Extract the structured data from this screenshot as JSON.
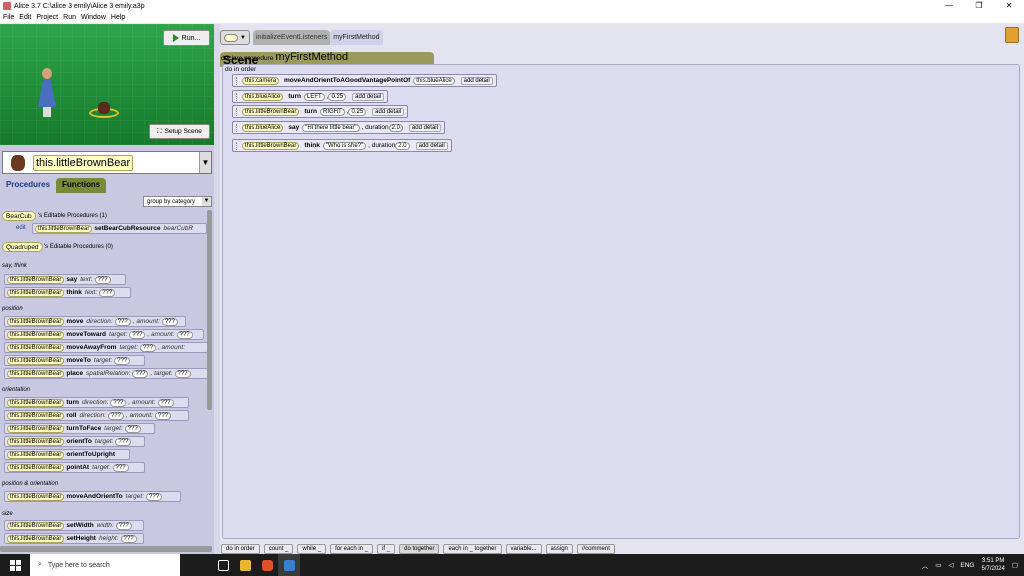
{
  "window": {
    "title": "Alice 3.7 C:\\alice 3 emily\\Alice 3 emily.a3p",
    "controls": [
      "—",
      "❐",
      "✕"
    ]
  },
  "menu": [
    "File",
    "Edit",
    "Project",
    "Run",
    "Window",
    "Help"
  ],
  "scene_view": {
    "run_label": "Run...",
    "setup_label": "Setup Scene"
  },
  "object_selector": {
    "value": "this.littleBrownBear"
  },
  "left_tabs": {
    "procedures": "Procedures",
    "functions": "Functions"
  },
  "group_by": "group by category",
  "editable": {
    "bearcub_type": "BearCub",
    "bearcub_text": "'s Editable Procedures (1)",
    "edit_label": "edit",
    "bearcub_method_ref": "this.littleBrownBear",
    "bearcub_method": "setBearCubResource",
    "bearcub_param": "bearCubR",
    "quadruped_type": "Quadruped",
    "quadruped_text": "'s Editable Procedures (0)"
  },
  "categories": {
    "say_think": "say, think",
    "position": "position",
    "orientation": "orientation",
    "position_orientation": "position & orientation",
    "size": "size"
  },
  "procedures": [
    {
      "ref": "this.littleBrownBear",
      "name": "say",
      "p1": "text:",
      "s1": "???"
    },
    {
      "ref": "this.littleBrownBear",
      "name": "think",
      "p1": "text:",
      "s1": "???"
    },
    {
      "ref": "this.littleBrownBear",
      "name": "move",
      "p1": "direction:",
      "s1": "???",
      "p2": ", amount:",
      "s2": "???"
    },
    {
      "ref": "this.littleBrownBear",
      "name": "moveToward",
      "p1": "target:",
      "s1": "???",
      "p2": ", amount:",
      "s2": "???"
    },
    {
      "ref": "this.littleBrownBear",
      "name": "moveAwayFrom",
      "p1": "target:",
      "s1": "???",
      "p2": ", amount:",
      "s2": ""
    },
    {
      "ref": "this.littleBrownBear",
      "name": "moveTo",
      "p1": "target:",
      "s1": "???"
    },
    {
      "ref": "this.littleBrownBear",
      "name": "place",
      "p1": "spatialRelation:",
      "s1": "???",
      "p2": ", target:",
      "s2": "???"
    },
    {
      "ref": "this.littleBrownBear",
      "name": "turn",
      "p1": "direction:",
      "s1": "???",
      "p2": ", amount:",
      "s2": "???"
    },
    {
      "ref": "this.littleBrownBear",
      "name": "roll",
      "p1": "direction:",
      "s1": "???",
      "p2": ", amount:",
      "s2": "???"
    },
    {
      "ref": "this.littleBrownBear",
      "name": "turnToFace",
      "p1": "target:",
      "s1": "???"
    },
    {
      "ref": "this.littleBrownBear",
      "name": "orientTo",
      "p1": "target:",
      "s1": "???"
    },
    {
      "ref": "this.littleBrownBear",
      "name": "orientToUpright"
    },
    {
      "ref": "this.littleBrownBear",
      "name": "pointAt",
      "p1": "target:",
      "s1": "???"
    },
    {
      "ref": "this.littleBrownBear",
      "name": "moveAndOrientTo",
      "p1": "target:",
      "s1": "???"
    },
    {
      "ref": "this.littleBrownBear",
      "name": "setWidth",
      "p1": "width:",
      "s1": "???"
    },
    {
      "ref": "this.littleBrownBear",
      "name": "setHeight",
      "p1": "height:",
      "s1": "???"
    }
  ],
  "editor_tabs": {
    "scene": "Scene",
    "initialize": "initializeEventListeners",
    "current": "myFirstMethod"
  },
  "method": {
    "declare": "declare procedure",
    "name": "myFirstMethod",
    "do_in_order": "do in order"
  },
  "statements": [
    {
      "ref": "this.camera",
      "name": "moveAndOrientToAGoodVantagePointOf",
      "a1": "this.blueAlice",
      "add": "add detail"
    },
    {
      "ref": "this.blueAlice",
      "name": "turn",
      "a1": "LEFT",
      "a2": "0.25",
      "add": "add detail"
    },
    {
      "ref": "this.littleBrownBear",
      "name": "turn",
      "a1": "RIGHT",
      "a2": "0.25",
      "add": "add detail"
    },
    {
      "ref": "this.blueAlice",
      "name": "say",
      "a1": "\"Hi there little bear\"",
      "dur": ", duration",
      "a2": "2.0",
      "add": "add detail"
    },
    {
      "ref": "this.littleBrownBear",
      "name": "think",
      "a1": "\"Who is she?\"",
      "dur": ", duration",
      "a2": "2.0",
      "add": "add detail"
    }
  ],
  "bottom_bar": [
    "do in order",
    "count _",
    "while _",
    "for each in _",
    "if _",
    "do together",
    "each in _ together",
    "variable...",
    "assign",
    "//comment"
  ],
  "taskbar": {
    "search_placeholder": "Type here to search",
    "lang": "ENG",
    "time": "3:51 PM",
    "date": "5/7/2024"
  }
}
